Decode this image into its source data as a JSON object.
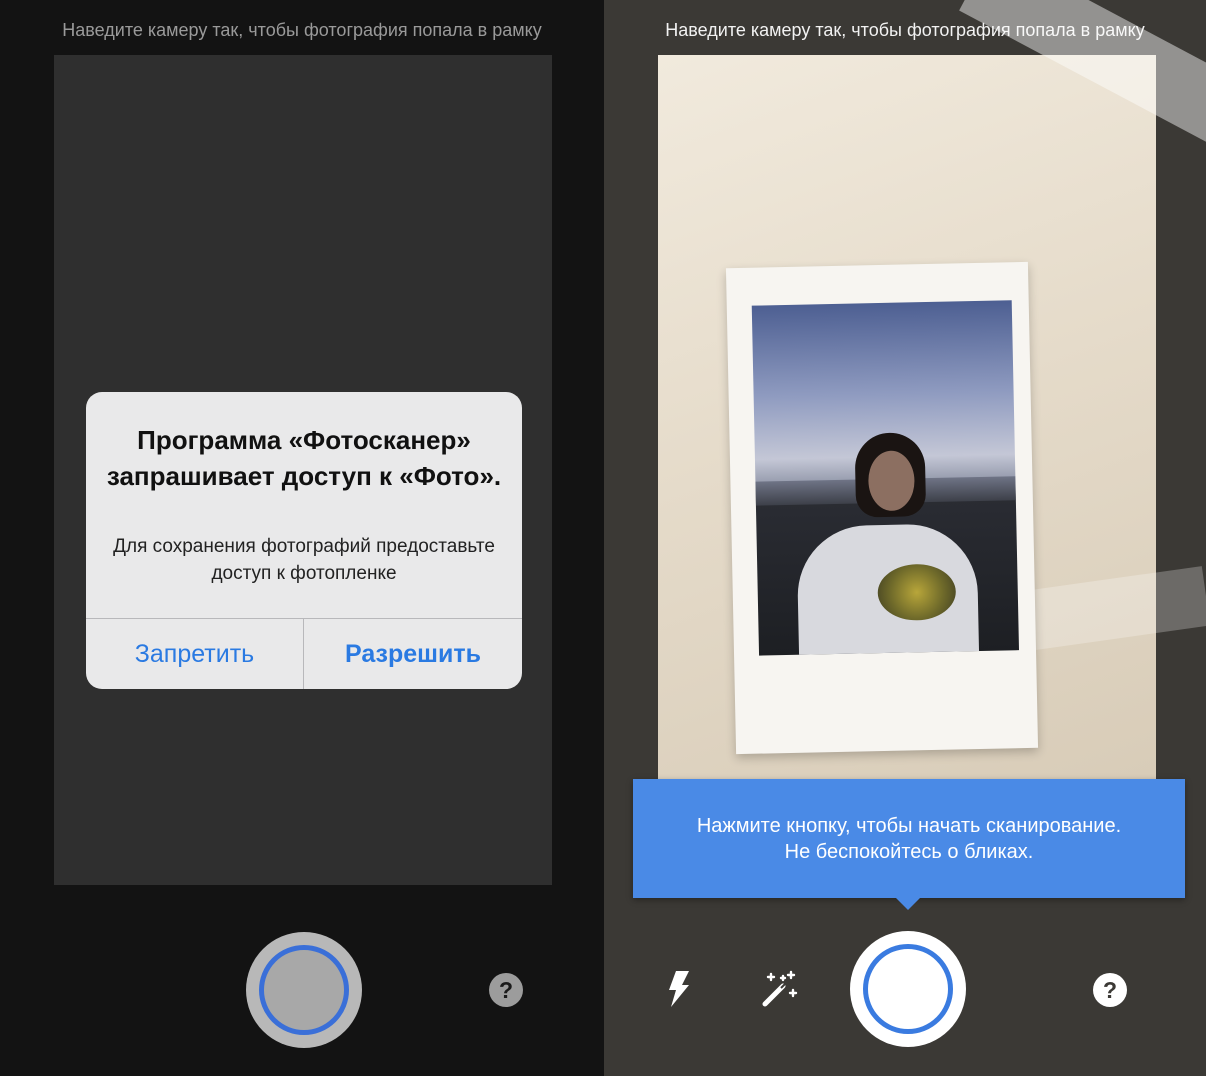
{
  "left_screen": {
    "hint": "Наведите камеру так, чтобы фотография попала в рамку",
    "alert": {
      "title": "Программа «Фотосканер» запрашивает доступ к «Фото».",
      "message": "Для сохранения фотографий предоставьте доступ к фотопленке",
      "deny_label": "Запретить",
      "allow_label": "Разрешить"
    },
    "help_symbol": "?"
  },
  "right_screen": {
    "hint": "Наведите камеру так, чтобы фотография попала в рамку",
    "tooltip": {
      "line1": "Нажмите кнопку, чтобы начать сканирование.",
      "line2": "Не беспокойтесь о бликах."
    },
    "help_symbol": "?"
  },
  "icons": {
    "flash": "flash-icon",
    "auto_enhance": "magic-wand-icon",
    "shutter": "shutter-icon",
    "help": "question-mark-icon"
  },
  "colors": {
    "accent_blue": "#2a7ae2",
    "tooltip_blue": "#4a8ae6",
    "shutter_ring": "#3a7be0"
  }
}
